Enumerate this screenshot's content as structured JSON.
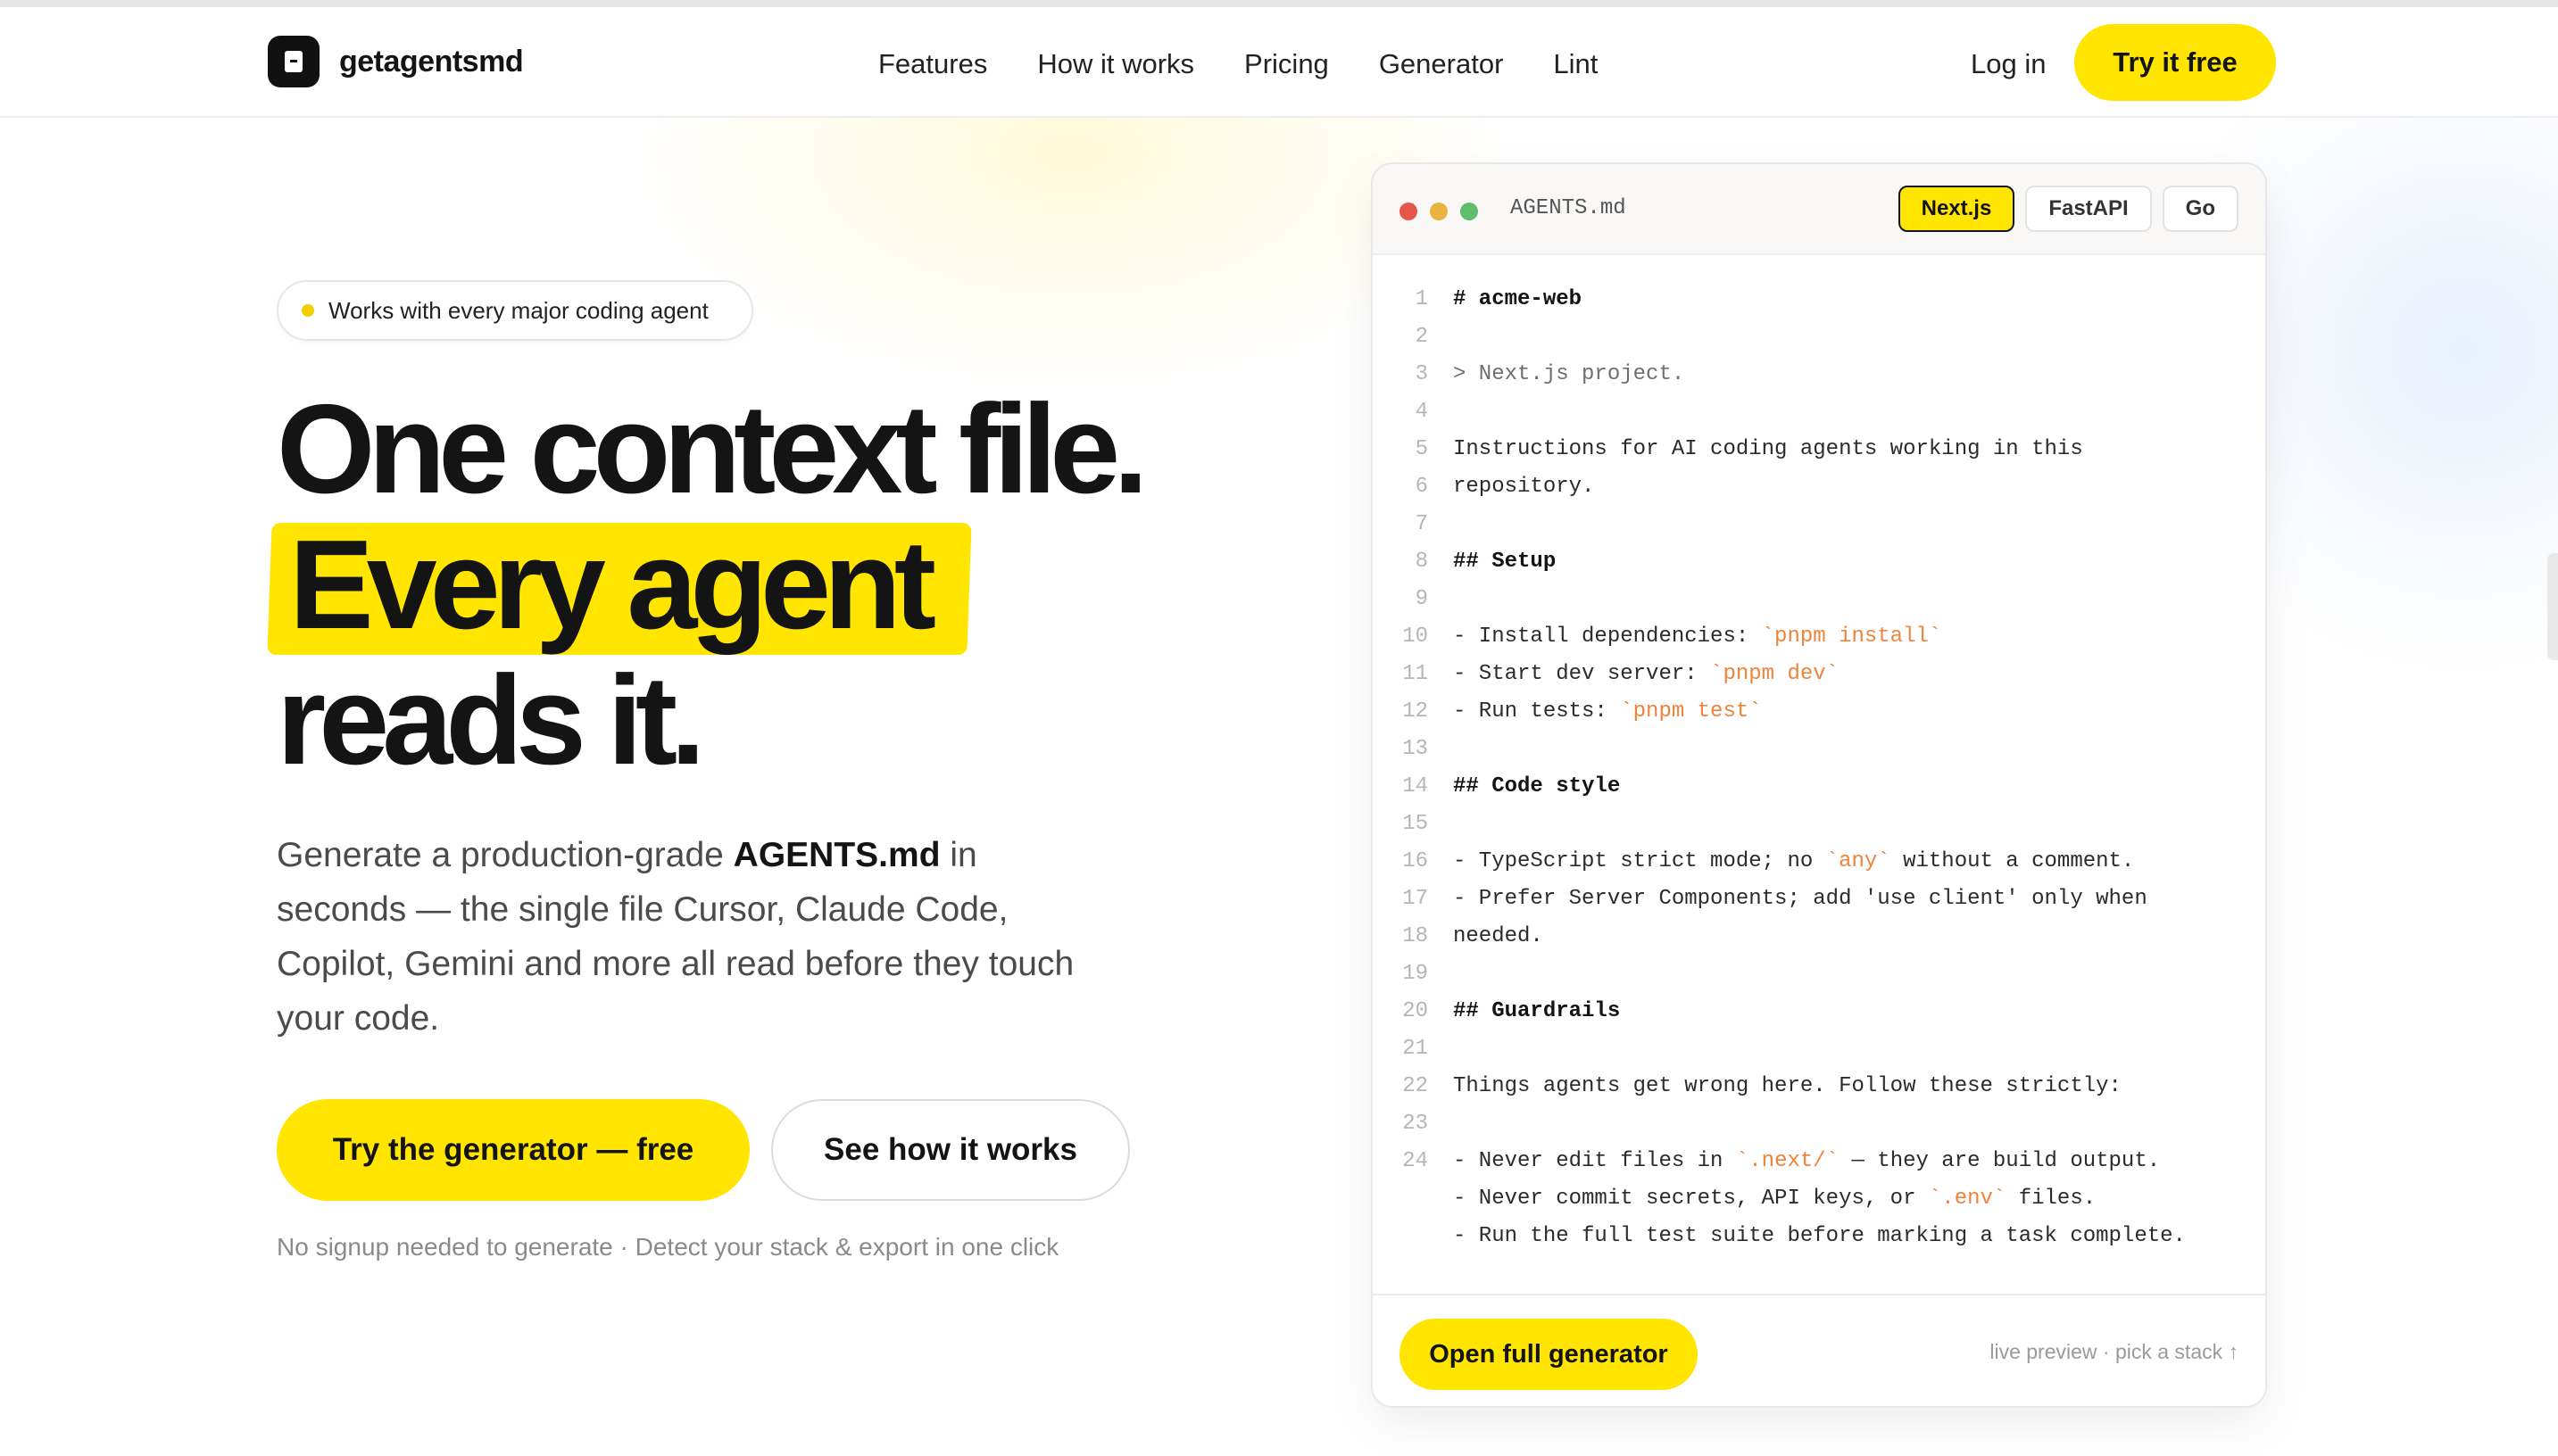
{
  "brand": {
    "name": "getagentsmd"
  },
  "nav": {
    "links": [
      "Features",
      "How it works",
      "Pricing",
      "Generator",
      "Lint"
    ],
    "login": "Log in",
    "cta": "Try it free"
  },
  "hero": {
    "badge": "Works with every major coding agent",
    "title_line1": "One context file.",
    "title_line2": "Every agent",
    "title_line3": "reads it.",
    "desc_pre": "Generate a production-grade ",
    "desc_bold": "AGENTS.md",
    "desc_post": " in seconds — the single file Cursor, Claude Code, Copilot, Gemini and more all read before they touch your code.",
    "primary_cta": "Try the generator — free",
    "secondary_cta": "See how it works",
    "fine_print": "No signup needed to generate · Detect your stack & export in one click"
  },
  "editor": {
    "file_name": "AGENTS.md",
    "tabs": [
      "Next.js",
      "FastAPI",
      "Go"
    ],
    "active_tab": "Next.js",
    "lines": [
      {
        "n": "1",
        "t": "# acme-web",
        "k": "h"
      },
      {
        "n": "2",
        "t": "",
        "k": ""
      },
      {
        "n": "3",
        "t": "> Next.js project.",
        "k": "q"
      },
      {
        "n": "4",
        "t": "",
        "k": ""
      },
      {
        "n": "5",
        "t": "Instructions for AI coding agents working in this",
        "k": ""
      },
      {
        "n": "6",
        "t": "repository.",
        "k": ""
      },
      {
        "n": "7",
        "t": "",
        "k": ""
      },
      {
        "n": "8",
        "t": "## Setup",
        "k": "h"
      },
      {
        "n": "9",
        "t": "",
        "k": ""
      },
      {
        "n": "10",
        "t": "- Install dependencies: ",
        "c": "`pnpm install`",
        "k": ""
      },
      {
        "n": "11",
        "t": "- Start dev server: ",
        "c": "`pnpm dev`",
        "k": ""
      },
      {
        "n": "12",
        "t": "- Run tests: ",
        "c": "`pnpm test`",
        "k": ""
      },
      {
        "n": "13",
        "t": "",
        "k": ""
      },
      {
        "n": "14",
        "t": "## Code style",
        "k": "h"
      },
      {
        "n": "15",
        "t": "",
        "k": ""
      },
      {
        "n": "16",
        "t": "- TypeScript strict mode; no ",
        "c": "`any`",
        "a": " without a comment.",
        "k": ""
      },
      {
        "n": "17",
        "t": "- Prefer Server Components; add 'use client' only when",
        "k": ""
      },
      {
        "n": "18",
        "t": "needed.",
        "k": ""
      },
      {
        "n": "19",
        "t": "",
        "k": ""
      },
      {
        "n": "20",
        "t": "## Guardrails",
        "k": "h"
      },
      {
        "n": "21",
        "t": "",
        "k": ""
      },
      {
        "n": "22",
        "t": "Things agents get wrong here. Follow these strictly:",
        "k": ""
      },
      {
        "n": "23",
        "t": "",
        "k": ""
      },
      {
        "n": "24",
        "t": "- Never edit files in ",
        "c": "`.next/`",
        "a": " — they are build output.",
        "k": ""
      },
      {
        "n": "",
        "t": "- Never commit secrets, API keys, or ",
        "c": "`.env`",
        "a": " files.",
        "k": ""
      },
      {
        "n": "",
        "t": "- Run the full test suite before marking a task complete.",
        "k": ""
      }
    ],
    "footer_cta": "Open full generator",
    "footer_hint": "live preview · pick a stack ↑"
  }
}
